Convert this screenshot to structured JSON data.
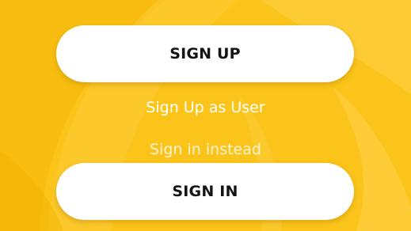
{
  "colors": {
    "background": "#fbc41a",
    "swoosh_light": "#ffd452",
    "swoosh_dark": "#f2b400",
    "button_bg": "#ffffff",
    "button_text": "#141414",
    "link_text": "#ffffff"
  },
  "auth": {
    "signup_label": "SIGN UP",
    "user_link_label": "Sign Up as User",
    "signin_link_label": "Sign in instead",
    "signin_label": "SIGN IN"
  }
}
